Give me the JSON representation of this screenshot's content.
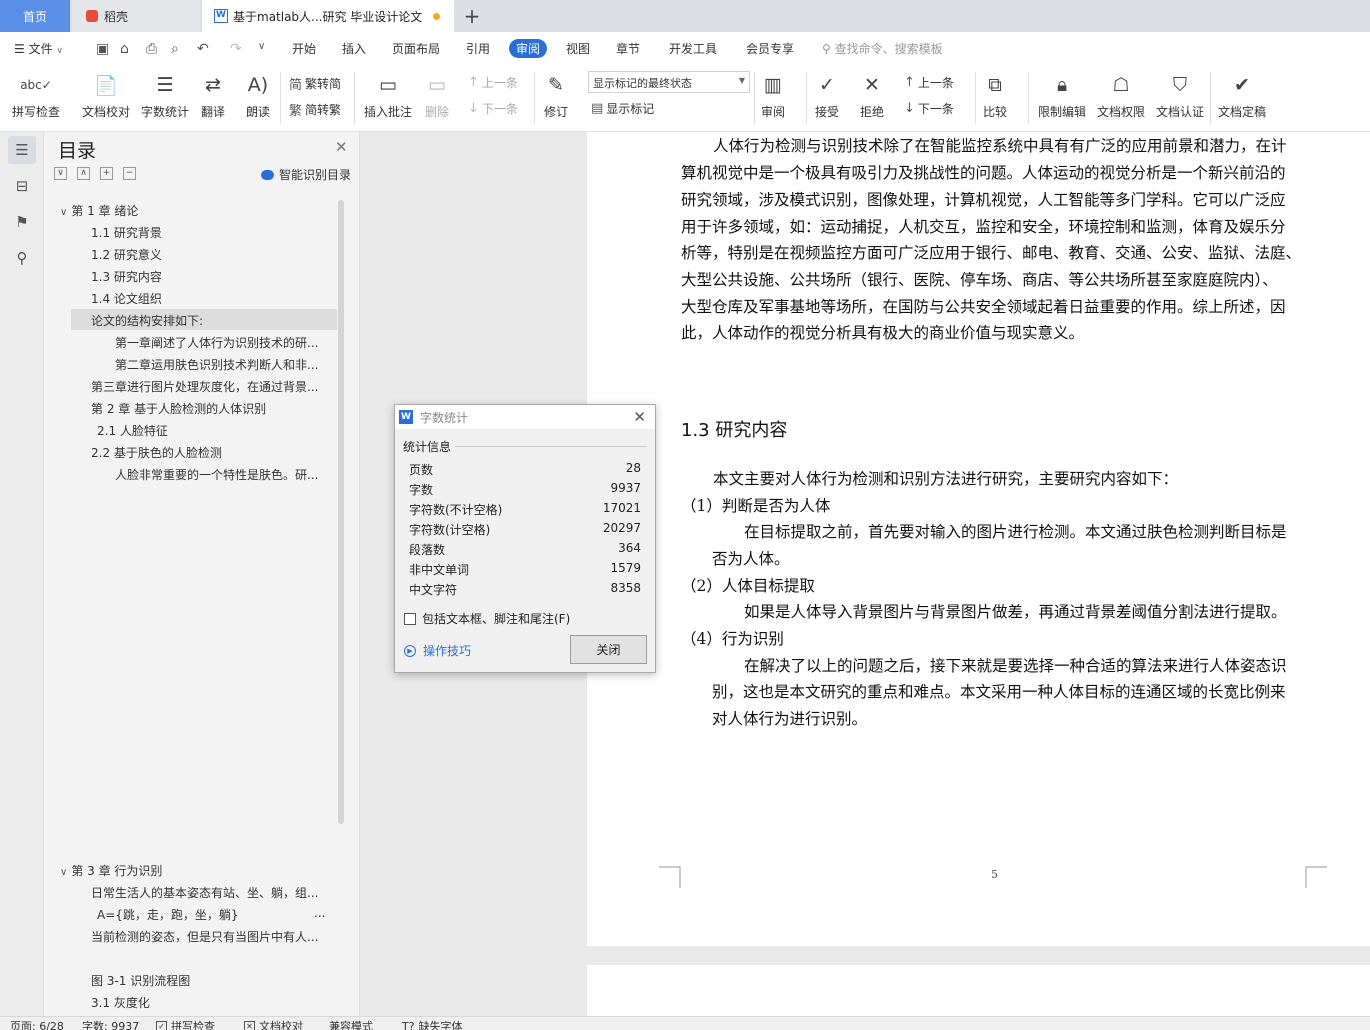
{
  "tabs": {
    "home": "首页",
    "daoke": "稻壳",
    "doc": "基于matlab人...研究 毕业设计论文",
    "new": "+"
  },
  "menu": {
    "file": "文件",
    "items": [
      "开始",
      "插入",
      "页面布局",
      "引用",
      "审阅",
      "视图",
      "章节",
      "开发工具",
      "会员专享"
    ],
    "active": "审阅",
    "search_placeholder": "查找命令、搜索模板"
  },
  "ribbon": {
    "spell": "拼写检查",
    "proof": "文档校对",
    "wordcount": "字数统计",
    "translate": "翻译",
    "read": "朗读",
    "to_trad": "繁转简",
    "to_simp": "简转繁",
    "insert_comment": "插入批注",
    "delete": "删除",
    "prev": "上一条",
    "next": "下一条",
    "revise": "修订",
    "markup_state": "显示标记的最终状态",
    "show_markup": "显示标记",
    "review": "审阅",
    "accept": "接受",
    "reject": "拒绝",
    "prev2": "上一条",
    "next2": "下一条",
    "compare": "比较",
    "restrict": "限制编辑",
    "perm": "文档权限",
    "auth": "文档认证",
    "finalize": "文档定稿"
  },
  "outline": {
    "title": "目录",
    "smart": "智能识别目录",
    "items": [
      {
        "text": "第 1 章  绪论"
      },
      {
        "text": "1.1  研究背景"
      },
      {
        "text": "1.2  研究意义"
      },
      {
        "text": "1.3  研究内容"
      },
      {
        "text": "1.4  论文组织"
      },
      {
        "text": "论文的结构安排如下:"
      },
      {
        "text": "第一章阐述了人体行为识别技术的研..."
      },
      {
        "text": "第二章运用肤色识别技术判断人和非..."
      },
      {
        "text": "第三章进行图片处理灰度化，在通过背景..."
      },
      {
        "text": "第 2 章  基于人脸检测的人体识别"
      },
      {
        "text": "2.1 人脸特征"
      },
      {
        "text": "2.2  基于肤色的人脸检测"
      },
      {
        "text": "人脸非常重要的一个特性是肤色。研..."
      },
      {
        "text": "第 3 章  行为识别"
      },
      {
        "text": "日常生活人的基本姿态有站、坐、躺，组..."
      },
      {
        "text": "A={跳，走，跑，坐，躺}"
      },
      {
        "text": "..."
      },
      {
        "text": "当前检测的姿态，但是只有当图片中有人..."
      },
      {
        "text": "图 3-1  识别流程图"
      },
      {
        "text": "3.1  灰度化"
      }
    ]
  },
  "document": {
    "para1": [
      "人体行为检测与识别技术除了在智能监控系统中具有有广泛的应用前景和潜力，在计",
      "算机视觉中是一个极具有吸引力及挑战性的问题。人体运动的视觉分析是一个新兴前沿的",
      "研究领域，涉及模式识别，图像处理，计算机视觉，人工智能等多门学科。它可以广泛应",
      "用于许多领域，如：运动捕捉，人机交互，监控和安全，环境控制和监测，体育及娱乐分",
      "析等，特别是在视频监控方面可广泛应用于银行、邮电、教育、交通、公安、监狱、法庭、",
      "大型公共设施、公共场所（银行、医院、停车场、商店、等公共场所甚至家庭庭院内）、",
      "大型仓库及军事基地等场所，在国防与公共安全领域起着日益重要的作用。综上所述，因",
      "此，人体动作的视觉分析具有极大的商业价值与现实意义。"
    ],
    "heading": "1.3  研究内容",
    "intro": "本文主要对人体行为检测和识别方法进行研究，主要研究内容如下：",
    "item1_title": "（1）判断是否为人体",
    "item1_body": [
      "在目标提取之前，首先要对输入的图片进行检测。本文通过肤色检测判断目标是",
      "否为人体。"
    ],
    "item2_title": "（2）人体目标提取",
    "item2_body": [
      "如果是人体导入背景图片与背景图片做差，再通过背景差阈值分割法进行提取。"
    ],
    "item4_title": "（4）行为识别",
    "item4_body": [
      "在解决了以上的问题之后，接下来就是要选择一种合适的算法来进行人体姿态识",
      "别，这也是本文研究的重点和难点。本文采用一种人体目标的连通区域的长宽比例来",
      "对人体行为进行识别。"
    ],
    "page_number": "5"
  },
  "dialog": {
    "title": "字数统计",
    "group": "统计信息",
    "rows": [
      {
        "label": "页数",
        "value": "28"
      },
      {
        "label": "字数",
        "value": "9937"
      },
      {
        "label": "字符数(不计空格)",
        "value": "17021"
      },
      {
        "label": "字符数(计空格)",
        "value": "20297"
      },
      {
        "label": "段落数",
        "value": "364"
      },
      {
        "label": "非中文单词",
        "value": "1579"
      },
      {
        "label": "中文字符",
        "value": "8358"
      }
    ],
    "checkbox": "包括文本框、脚注和尾注(F)",
    "tips": "操作技巧",
    "close": "关闭"
  },
  "status": {
    "page": "页面: 6/28",
    "words": "字数: 9937",
    "spell": "拼写检查",
    "proof": "文档校对",
    "compat": "兼容模式",
    "missing_font": "缺失字体"
  },
  "colors": {
    "accent": "#2b6fd6",
    "home_tab": "#5b8ee6",
    "unsaved_dot": "#f5a623"
  }
}
